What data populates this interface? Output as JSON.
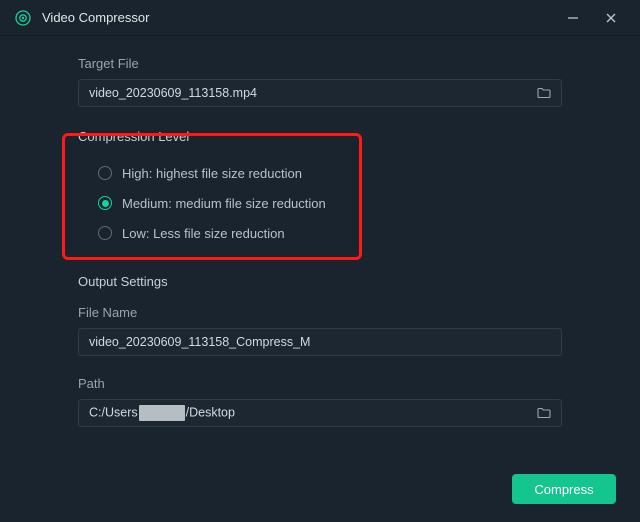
{
  "titlebar": {
    "title": "Video Compressor"
  },
  "targetFile": {
    "label": "Target File",
    "value": "video_20230609_113158.mp4"
  },
  "compression": {
    "title": "Compression Level",
    "options": [
      {
        "label": "High: highest file size reduction",
        "selected": false
      },
      {
        "label": "Medium: medium file size reduction",
        "selected": true
      },
      {
        "label": "Low: Less file size reduction",
        "selected": false
      }
    ]
  },
  "output": {
    "title": "Output Settings",
    "fileNameLabel": "File Name",
    "fileNameValue": "video_20230609_113158_Compress_M",
    "pathLabel": "Path",
    "pathPrefix": "C:/Users",
    "pathSuffix": "/Desktop"
  },
  "actions": {
    "compress": "Compress"
  }
}
